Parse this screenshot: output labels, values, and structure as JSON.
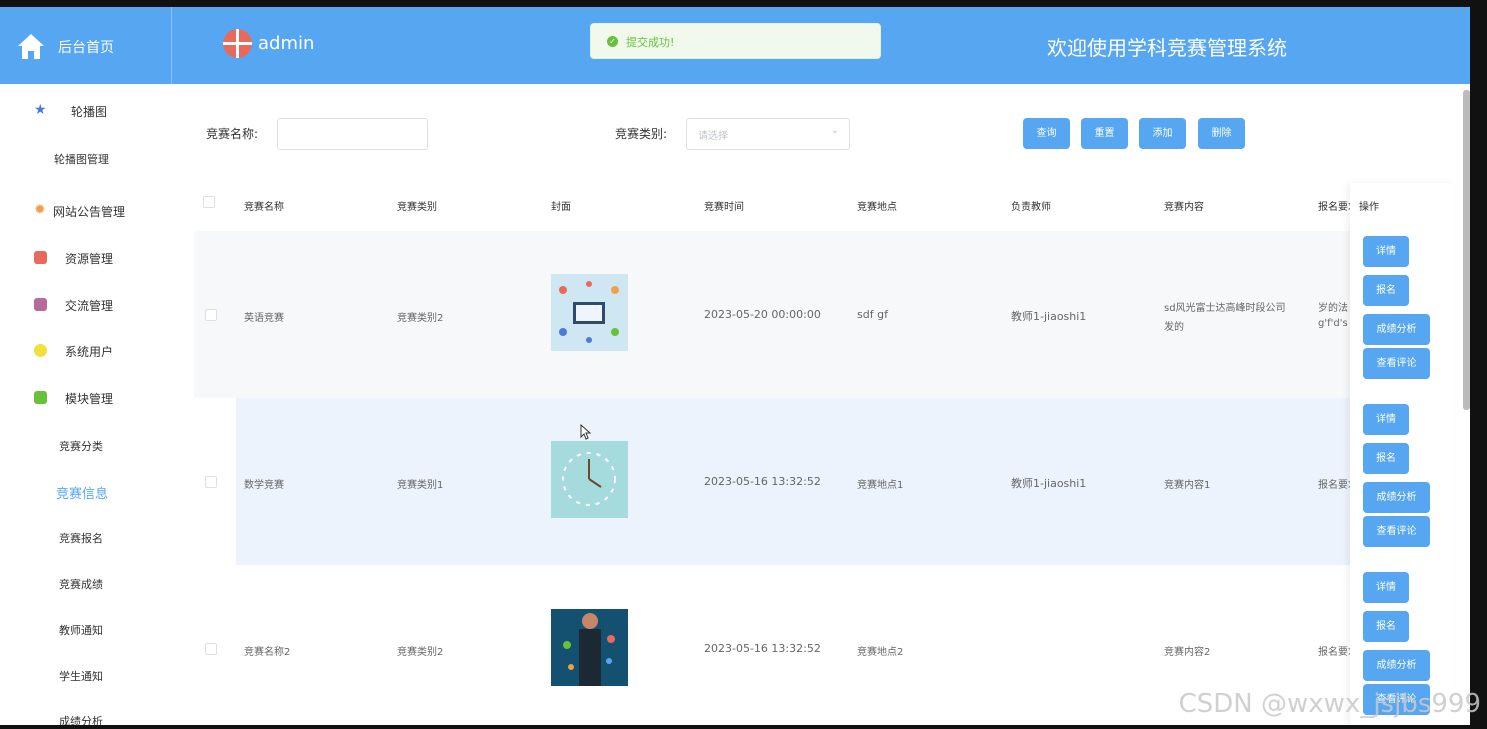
{
  "header": {
    "home_label": "后台首页",
    "user_name": "admin",
    "welcome": "欢迎使用学科竞赛管理系统",
    "toast": "提交成功!",
    "accent": "#56a6f2"
  },
  "sidebar": {
    "items": [
      {
        "label": "轮播图",
        "icon": "star-icon"
      },
      {
        "label": "轮播图管理"
      },
      {
        "label": "网站公告管理",
        "icon": "gear-icon"
      },
      {
        "label": "资源管理",
        "icon": "grid-icon"
      },
      {
        "label": "交流管理",
        "icon": "box-icon"
      },
      {
        "label": "系统用户",
        "icon": "cube-icon"
      },
      {
        "label": "模块管理",
        "icon": "chat-icon"
      }
    ],
    "sub_items": [
      "竞赛分类",
      "竞赛信息",
      "竞赛报名",
      "竞赛成绩",
      "教师通知",
      "学生通知",
      "成绩分析"
    ],
    "active": "竞赛信息"
  },
  "search": {
    "name_label": "竞赛名称:",
    "name_value": "",
    "type_label": "竞赛类别:",
    "type_placeholder": "请选择",
    "buttons": [
      "查询",
      "重置",
      "添加",
      "删除"
    ]
  },
  "table": {
    "headers": [
      "竞赛名称",
      "竞赛类别",
      "封面",
      "竞赛时间",
      "竞赛地点",
      "负责教师",
      "竞赛内容",
      "报名要求",
      "操作"
    ],
    "rows": [
      {
        "name": "英语竞赛",
        "type": "竞赛类别2",
        "time": "2023-05-20 00:00:00",
        "place": "sdf gf",
        "teacher": "教师1-jiaoshi1",
        "content_l1": "sd风光富士达高峰时段公司",
        "content_l2": "发的",
        "req_l1": "岁的法",
        "req_l2": "g'f'd's"
      },
      {
        "name": "数学竞赛",
        "type": "竞赛类别1",
        "time": "2023-05-16 13:32:52",
        "place": "竞赛地点1",
        "teacher": "教师1-jiaoshi1",
        "content_l1": "竞赛内容1",
        "content_l2": "",
        "req_l1": "报名要求",
        "req_l2": ""
      },
      {
        "name": "竞赛名称2",
        "type": "竞赛类别2",
        "time": "2023-05-16 13:32:52",
        "place": "竞赛地点2",
        "teacher": "",
        "content_l1": "竞赛内容2",
        "content_l2": "",
        "req_l1": "报名要求",
        "req_l2": ""
      }
    ],
    "actions": [
      "详情",
      "报名",
      "成绩分析",
      "查看评论"
    ]
  },
  "watermark": "CSDN @wxwx_jsjbs999"
}
